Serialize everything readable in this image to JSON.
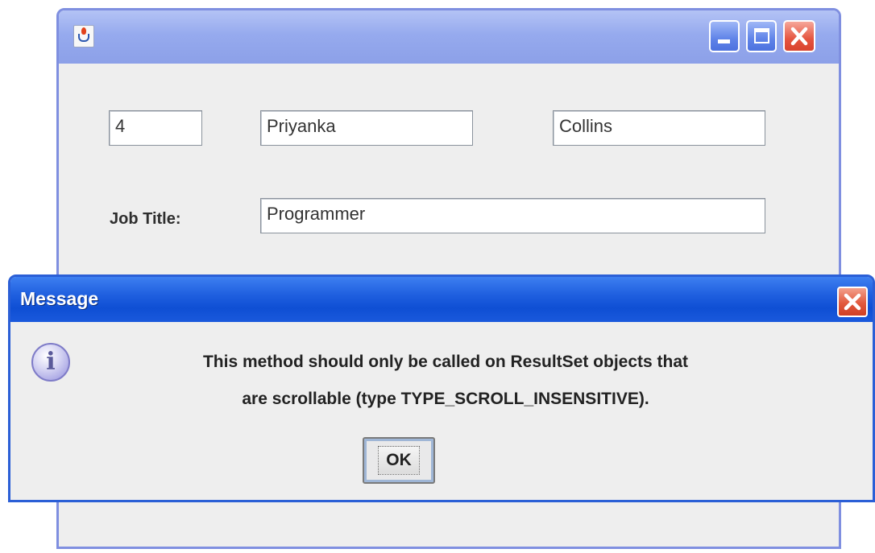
{
  "main_window": {
    "fields": {
      "id": "4",
      "first_name": "Priyanka",
      "last_name": "Collins",
      "job_title_label": "Job Title:",
      "job_title": "Programmer"
    }
  },
  "dialog": {
    "title": "Message",
    "message_line1": "This method should only be called on ResultSet objects that",
    "message_line2": "are scrollable (type TYPE_SCROLL_INSENSITIVE).",
    "ok_label": "OK",
    "icon": "info-icon"
  },
  "colors": {
    "main_title_bar": "#96aaee",
    "dialog_title_bar": "#1f5fdf",
    "close_button": "#e2593d",
    "window_bg": "#eeeeee"
  }
}
